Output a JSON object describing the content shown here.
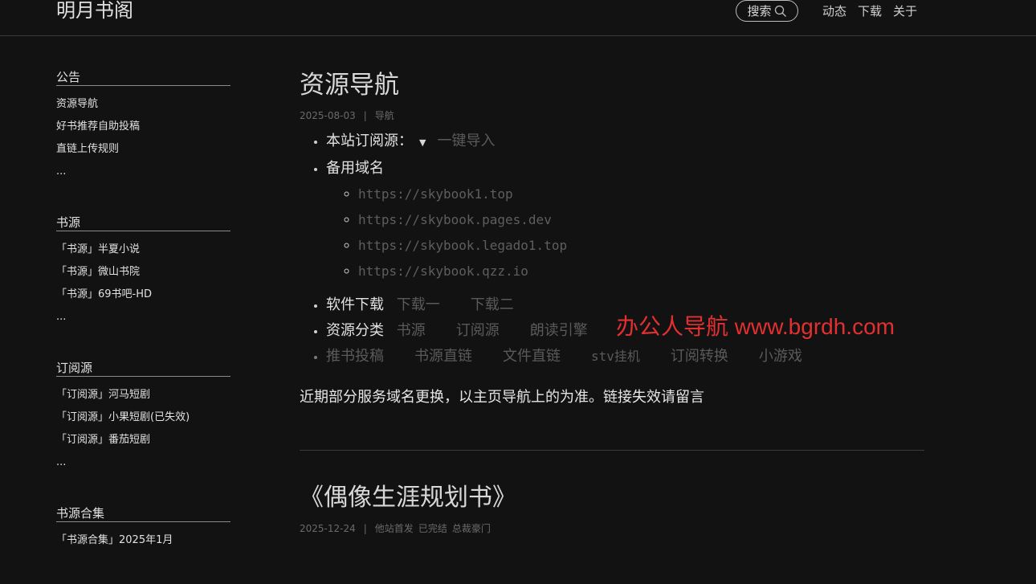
{
  "header": {
    "site_title": "明月书阁",
    "search_label": "搜索",
    "nav": [
      "动态",
      "下载",
      "关于"
    ]
  },
  "sidebar": {
    "sections": [
      {
        "heading": "公告",
        "items": [
          "资源导航",
          "好书推荐自助投稿",
          "直链上传规则"
        ],
        "more": "..."
      },
      {
        "heading": "书源",
        "items": [
          "「书源」半夏小说",
          "「书源」微山书院",
          "「书源」69书吧-HD"
        ],
        "more": "..."
      },
      {
        "heading": "订阅源",
        "items": [
          "「订阅源」河马短剧",
          "「订阅源」小果短剧(已失效)",
          "「订阅源」番茄短剧"
        ],
        "more": "..."
      },
      {
        "heading": "书源合集",
        "items": [
          "「书源合集」2025年1月"
        ]
      }
    ]
  },
  "post1": {
    "title": "资源导航",
    "date": "2025-08-03",
    "separator": "|",
    "category": "导航",
    "subscribe_label": "本站订阅源：",
    "dropdown_icon": "▼",
    "import_link": "一键导入",
    "domains_label": "备用域名",
    "domains": [
      "https://skybook1.top",
      "https://skybook.pages.dev",
      "https://skybook.legado1.top",
      "https://skybook.qzz.io"
    ],
    "download_label": "软件下载",
    "download_links": [
      "下载一",
      "下载二"
    ],
    "category_label": "资源分类",
    "category_links": [
      "书源",
      "订阅源",
      "朗读引擎"
    ],
    "extra_links": [
      "推书投稿",
      "书源直链",
      "文件直链",
      "stv挂机",
      "订阅转换",
      "小游戏"
    ],
    "notice": "近期部分服务域名更换，以主页导航上的为准。链接失效请留言"
  },
  "post2": {
    "title": "《偶像生涯规划书》",
    "date": "2025-12-24",
    "separator": "|",
    "tags": [
      "他站首发",
      "已完结",
      "总裁豪门"
    ]
  },
  "watermark": "办公人导航 www.bgrdh.com",
  "colors": {
    "background": "#121212",
    "watermark": "#e23030",
    "faint_link": "#5a5a5a"
  }
}
